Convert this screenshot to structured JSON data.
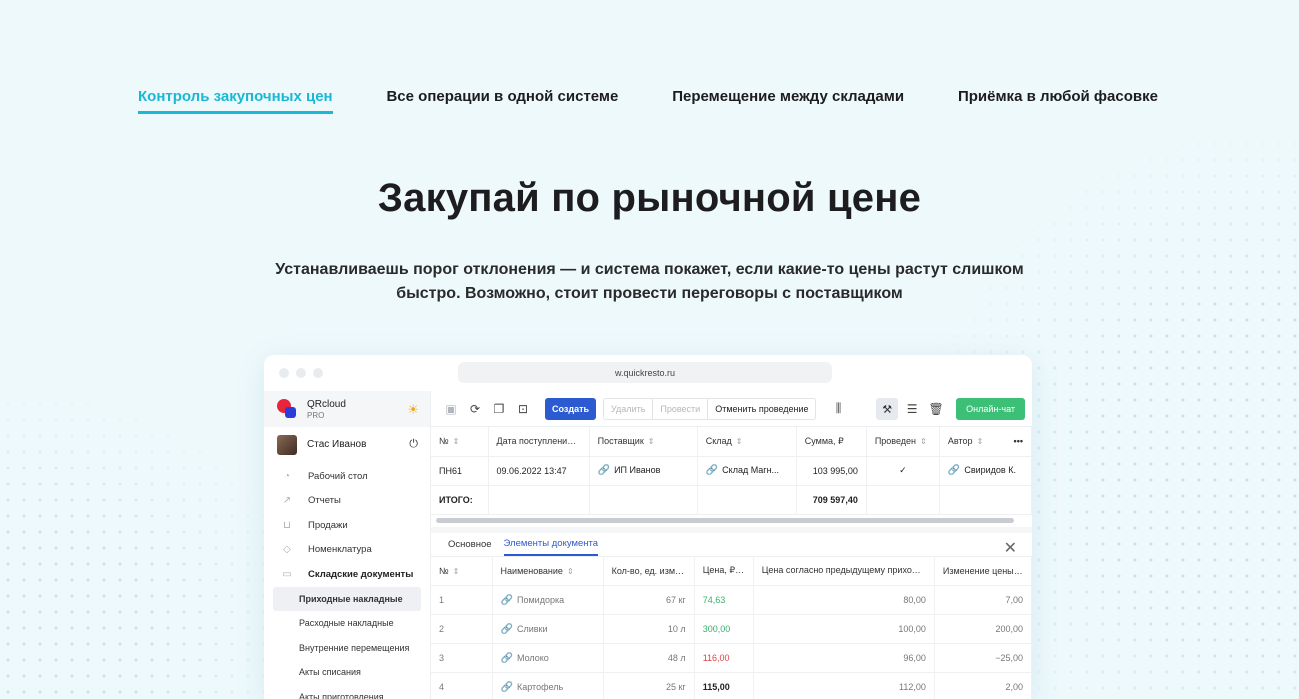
{
  "tabs": [
    {
      "label": "Контроль закупочных цен",
      "active": true
    },
    {
      "label": "Все операции в одной системе",
      "active": false
    },
    {
      "label": "Перемещение между складами",
      "active": false
    },
    {
      "label": "Приёмка в любой фасовке",
      "active": false
    }
  ],
  "hero": {
    "title": "Закупай по рыночной цене",
    "subtitle_line1": "Устанавливаешь порог отклонения — и система покажет, если какие-то цены растут слишком",
    "subtitle_line2": "быстро. Возможно, стоит провести переговоры с поставщиком"
  },
  "window": {
    "url": "w.quickresto.ru"
  },
  "sidebar": {
    "brand": "QRcloud",
    "brand_sub": "PRO",
    "user": "Стас Иванов",
    "items": [
      {
        "label": "Рабочий стол",
        "icon": "dashboard-icon"
      },
      {
        "label": "Отчеты",
        "icon": "chart-icon"
      },
      {
        "label": "Продажи",
        "icon": "basket-icon"
      },
      {
        "label": "Номенклатура",
        "icon": "tag-icon"
      },
      {
        "label": "Складские документы",
        "icon": "box-icon"
      }
    ],
    "subitems": [
      "Приходные накладные",
      "Расходные накладные",
      "Внутренние перемещения",
      "Акты списания",
      "Акты приготовления"
    ]
  },
  "toolbar": {
    "create": "Создать",
    "delete": "Удалить",
    "post": "Провести",
    "unpost": "Отменить проведение",
    "chat": "Онлайн-чат"
  },
  "doc_table": {
    "headers": [
      "№",
      "Дата поступления",
      "Поставщик",
      "Склад",
      "Сумма, ₽",
      "Проведен",
      "Автор"
    ],
    "row": {
      "num": "ПН61",
      "date": "09.06.2022 13:47",
      "supplier": "ИП Иванов",
      "warehouse": "Склад Магн...",
      "sum": "103 995,00",
      "author": "Свиридов К."
    },
    "total_label": "ИТОГО:",
    "total_sum": "709 597,40"
  },
  "sub_tabs": [
    "Основное",
    "Элементы документа"
  ],
  "items_table": {
    "headers": [
      "№",
      "Наименование",
      "Кол-во, ед. изм.",
      "Цена, ₽",
      "Цена согласно предыдущему приходу, ₽",
      "Изменение цены, %"
    ],
    "rows": [
      {
        "n": "1",
        "name": "Помидорка",
        "qty": "67 кг",
        "price": "74,63",
        "prev": "80,00",
        "change": "7,00",
        "color": "green"
      },
      {
        "n": "2",
        "name": "Сливки",
        "qty": "10 л",
        "price": "300,00",
        "prev": "100,00",
        "change": "200,00",
        "color": "green"
      },
      {
        "n": "3",
        "name": "Молоко",
        "qty": "48 л",
        "price": "116,00",
        "prev": "96,00",
        "change": "−25,00",
        "color": "red"
      },
      {
        "n": "4",
        "name": "Картофель",
        "qty": "25 кг",
        "price": "115,00",
        "prev": "112,00",
        "change": "2,00",
        "color": "black"
      }
    ]
  }
}
